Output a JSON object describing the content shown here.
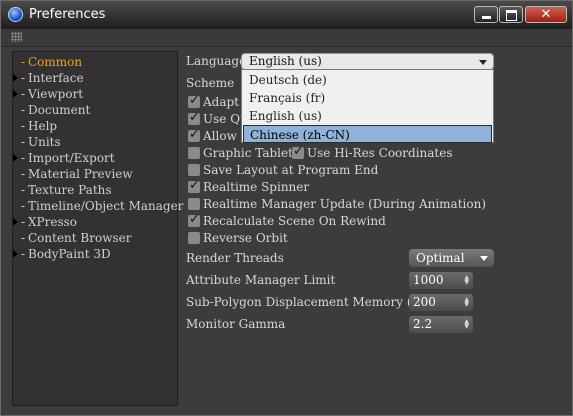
{
  "window": {
    "title": "Preferences"
  },
  "sidebar": {
    "items": [
      {
        "label": "Common",
        "selected": true,
        "expandable": false
      },
      {
        "label": "Interface",
        "selected": false,
        "expandable": true
      },
      {
        "label": "Viewport",
        "selected": false,
        "expandable": true
      },
      {
        "label": "Document",
        "selected": false,
        "expandable": false
      },
      {
        "label": "Help",
        "selected": false,
        "expandable": false
      },
      {
        "label": "Units",
        "selected": false,
        "expandable": false
      },
      {
        "label": "Import/Export",
        "selected": false,
        "expandable": true
      },
      {
        "label": "Material Preview",
        "selected": false,
        "expandable": false
      },
      {
        "label": "Texture Paths",
        "selected": false,
        "expandable": false
      },
      {
        "label": "Timeline/Object Manager",
        "selected": false,
        "expandable": false
      },
      {
        "label": "XPresso",
        "selected": false,
        "expandable": true
      },
      {
        "label": "Content Browser",
        "selected": false,
        "expandable": false
      },
      {
        "label": "BodyPaint 3D",
        "selected": false,
        "expandable": true
      }
    ]
  },
  "language": {
    "label": "Language",
    "value": "English (us)",
    "options": [
      "Deutsch (de)",
      "Français (fr)",
      "English (us)",
      "Chinese (zh-CN)"
    ],
    "highlighted": "Chinese (zh-CN)"
  },
  "scheme": {
    "label": "Scheme"
  },
  "checkboxes": {
    "adapt": {
      "label": "Adapt",
      "checked": true
    },
    "use_qu": {
      "label": "Use Qu",
      "checked": true
    },
    "allow": {
      "label": "Allow",
      "checked": true
    },
    "graphic_tablet": {
      "label": "Graphic Tablet",
      "checked": false
    },
    "hires_coords": {
      "label": "Use Hi-Res Coordinates",
      "checked": true
    },
    "save_layout": {
      "label": "Save Layout at Program End",
      "checked": false
    },
    "realtime_spinner": {
      "label": "Realtime Spinner",
      "checked": true
    },
    "realtime_manager": {
      "label": "Realtime Manager Update (During Animation)",
      "checked": false
    },
    "recalc_scene": {
      "label": "Recalculate Scene On Rewind",
      "checked": true
    },
    "reverse_orbit": {
      "label": "Reverse Orbit",
      "checked": false
    }
  },
  "render_threads": {
    "label": "Render Threads",
    "value": "Optimal"
  },
  "attr_manager_limit": {
    "label": "Attribute Manager Limit",
    "value": "1000"
  },
  "subpoly_memory": {
    "label": "Sub-Polygon Displacement Memory (MB)",
    "value": "200"
  },
  "monitor_gamma": {
    "label": "Monitor Gamma",
    "value": "2.2"
  }
}
